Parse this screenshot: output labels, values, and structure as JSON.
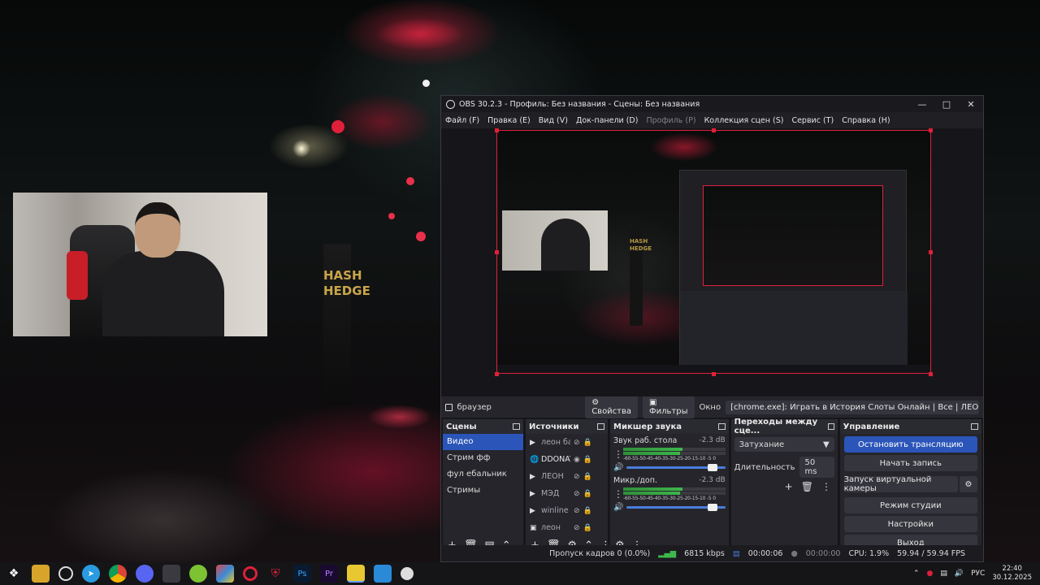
{
  "obs": {
    "title": "OBS 30.2.3 - Профиль: Без названия - Сцены: Без названия",
    "menu": [
      {
        "label": "Файл (F)",
        "enabled": true
      },
      {
        "label": "Правка (E)",
        "enabled": true
      },
      {
        "label": "Вид (V)",
        "enabled": true
      },
      {
        "label": "Док-панели (D)",
        "enabled": true
      },
      {
        "label": "Профиль (P)",
        "enabled": false
      },
      {
        "label": "Коллекция сцен (S)",
        "enabled": true
      },
      {
        "label": "Сервис (T)",
        "enabled": true
      },
      {
        "label": "Справка (H)",
        "enabled": true
      }
    ],
    "source_bar": {
      "source_name": "браузер",
      "properties_label": "Свойства",
      "filters_label": "Фильтры",
      "window_label": "Окно",
      "window_value": "[chrome.exe]: Играть в История Слоты Онлайн | Все | ЛЕОН - Google Chrome"
    },
    "scenes": {
      "title": "Сцены",
      "items": [
        "Видео",
        "Стрим фф",
        "фул ебальник",
        "Стримы"
      ],
      "selected": "Видео"
    },
    "sources": {
      "title": "Источники",
      "items": [
        {
          "label": "леон баг",
          "icon": "play-icon",
          "visible": false
        },
        {
          "label": "DDONAT",
          "icon": "globe-icon",
          "visible": true
        },
        {
          "label": "ЛЕОН",
          "icon": "play-icon",
          "visible": false
        },
        {
          "label": "МЭД",
          "icon": "play-icon",
          "visible": false
        },
        {
          "label": "winline €",
          "icon": "play-icon",
          "visible": false
        },
        {
          "label": "леон",
          "icon": "image-icon",
          "visible": false
        }
      ]
    },
    "mixer": {
      "title": "Микшер звука",
      "channels": [
        {
          "name": "Звук раб. стола",
          "db": "-2.3 dB"
        },
        {
          "name": "Микр./доп.",
          "db": "-2.3 dB"
        }
      ],
      "scale": "-60-55-50-45-40-35-30-25-20-15-10 -5 0"
    },
    "transitions": {
      "title": "Переходы между сце...",
      "selected": "Затухание",
      "duration_label": "Длительность",
      "duration_value": "50 ms"
    },
    "controls": {
      "title": "Управление",
      "stop_stream": "Остановить трансляцию",
      "start_record": "Начать запись",
      "virtual_cam": "Запуск виртуальной камеры",
      "studio_mode": "Режим студии",
      "settings": "Настройки",
      "exit": "Выход"
    },
    "status": {
      "dropped": "Пропуск кадров 0 (0.0%)",
      "bitrate": "6815 kbps",
      "stream_time": "00:00:06",
      "record_time": "00:00:00",
      "cpu": "CPU: 1.9%",
      "fps": "59.94 / 59.94 FPS"
    }
  },
  "wallpaper": {
    "banner_text": "HASH HEDGE"
  },
  "taskbar": {
    "apps": [
      "start-icon",
      "explorer-icon",
      "obs-icon",
      "telegram-icon",
      "chrome-icon",
      "discord-icon",
      "steam-icon",
      "android-icon",
      "winrar-icon",
      "opera-icon",
      "shield-icon",
      "photoshop-icon",
      "premiere-icon",
      "files-icon",
      "vpn-icon",
      "other-icon"
    ],
    "app_labels": {
      "photoshop": "Ps",
      "premiere": "Pr"
    },
    "language": "РУС",
    "time": "22:40",
    "date": "30.12.2025"
  },
  "colors": {
    "accent": "#2b55b8",
    "selection_outline": "#e0203a",
    "meter_green": "#3fb84b"
  }
}
